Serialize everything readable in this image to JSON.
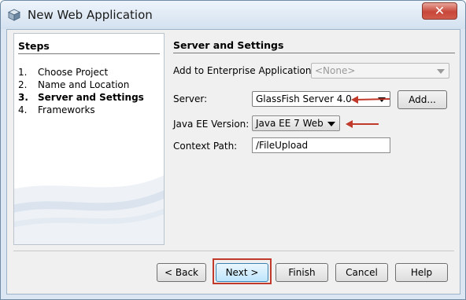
{
  "window": {
    "title": "New Web Application",
    "icons": {
      "app": "cube-icon",
      "close": "close-icon"
    }
  },
  "steps": {
    "heading": "Steps",
    "items": [
      {
        "number": "1.",
        "label": "Choose Project"
      },
      {
        "number": "2.",
        "label": "Name and Location"
      },
      {
        "number": "3.",
        "label": "Server and Settings",
        "current": true
      },
      {
        "number": "4.",
        "label": "Frameworks"
      }
    ]
  },
  "settings": {
    "heading": "Server and Settings",
    "enterprise_label": "Add to Enterprise Application:",
    "enterprise_value": "<None>",
    "server_label": "Server:",
    "server_value": "GlassFish Server 4.0",
    "add_label": "Add...",
    "javaee_label": "Java EE Version:",
    "javaee_value": "Java EE 7 Web",
    "context_label": "Context Path:",
    "context_value": "/FileUpload"
  },
  "buttons": {
    "back": "< Back",
    "next": "Next >",
    "finish": "Finish",
    "cancel": "Cancel",
    "help": "Help"
  },
  "annotations": {
    "color": "#c0392b"
  }
}
